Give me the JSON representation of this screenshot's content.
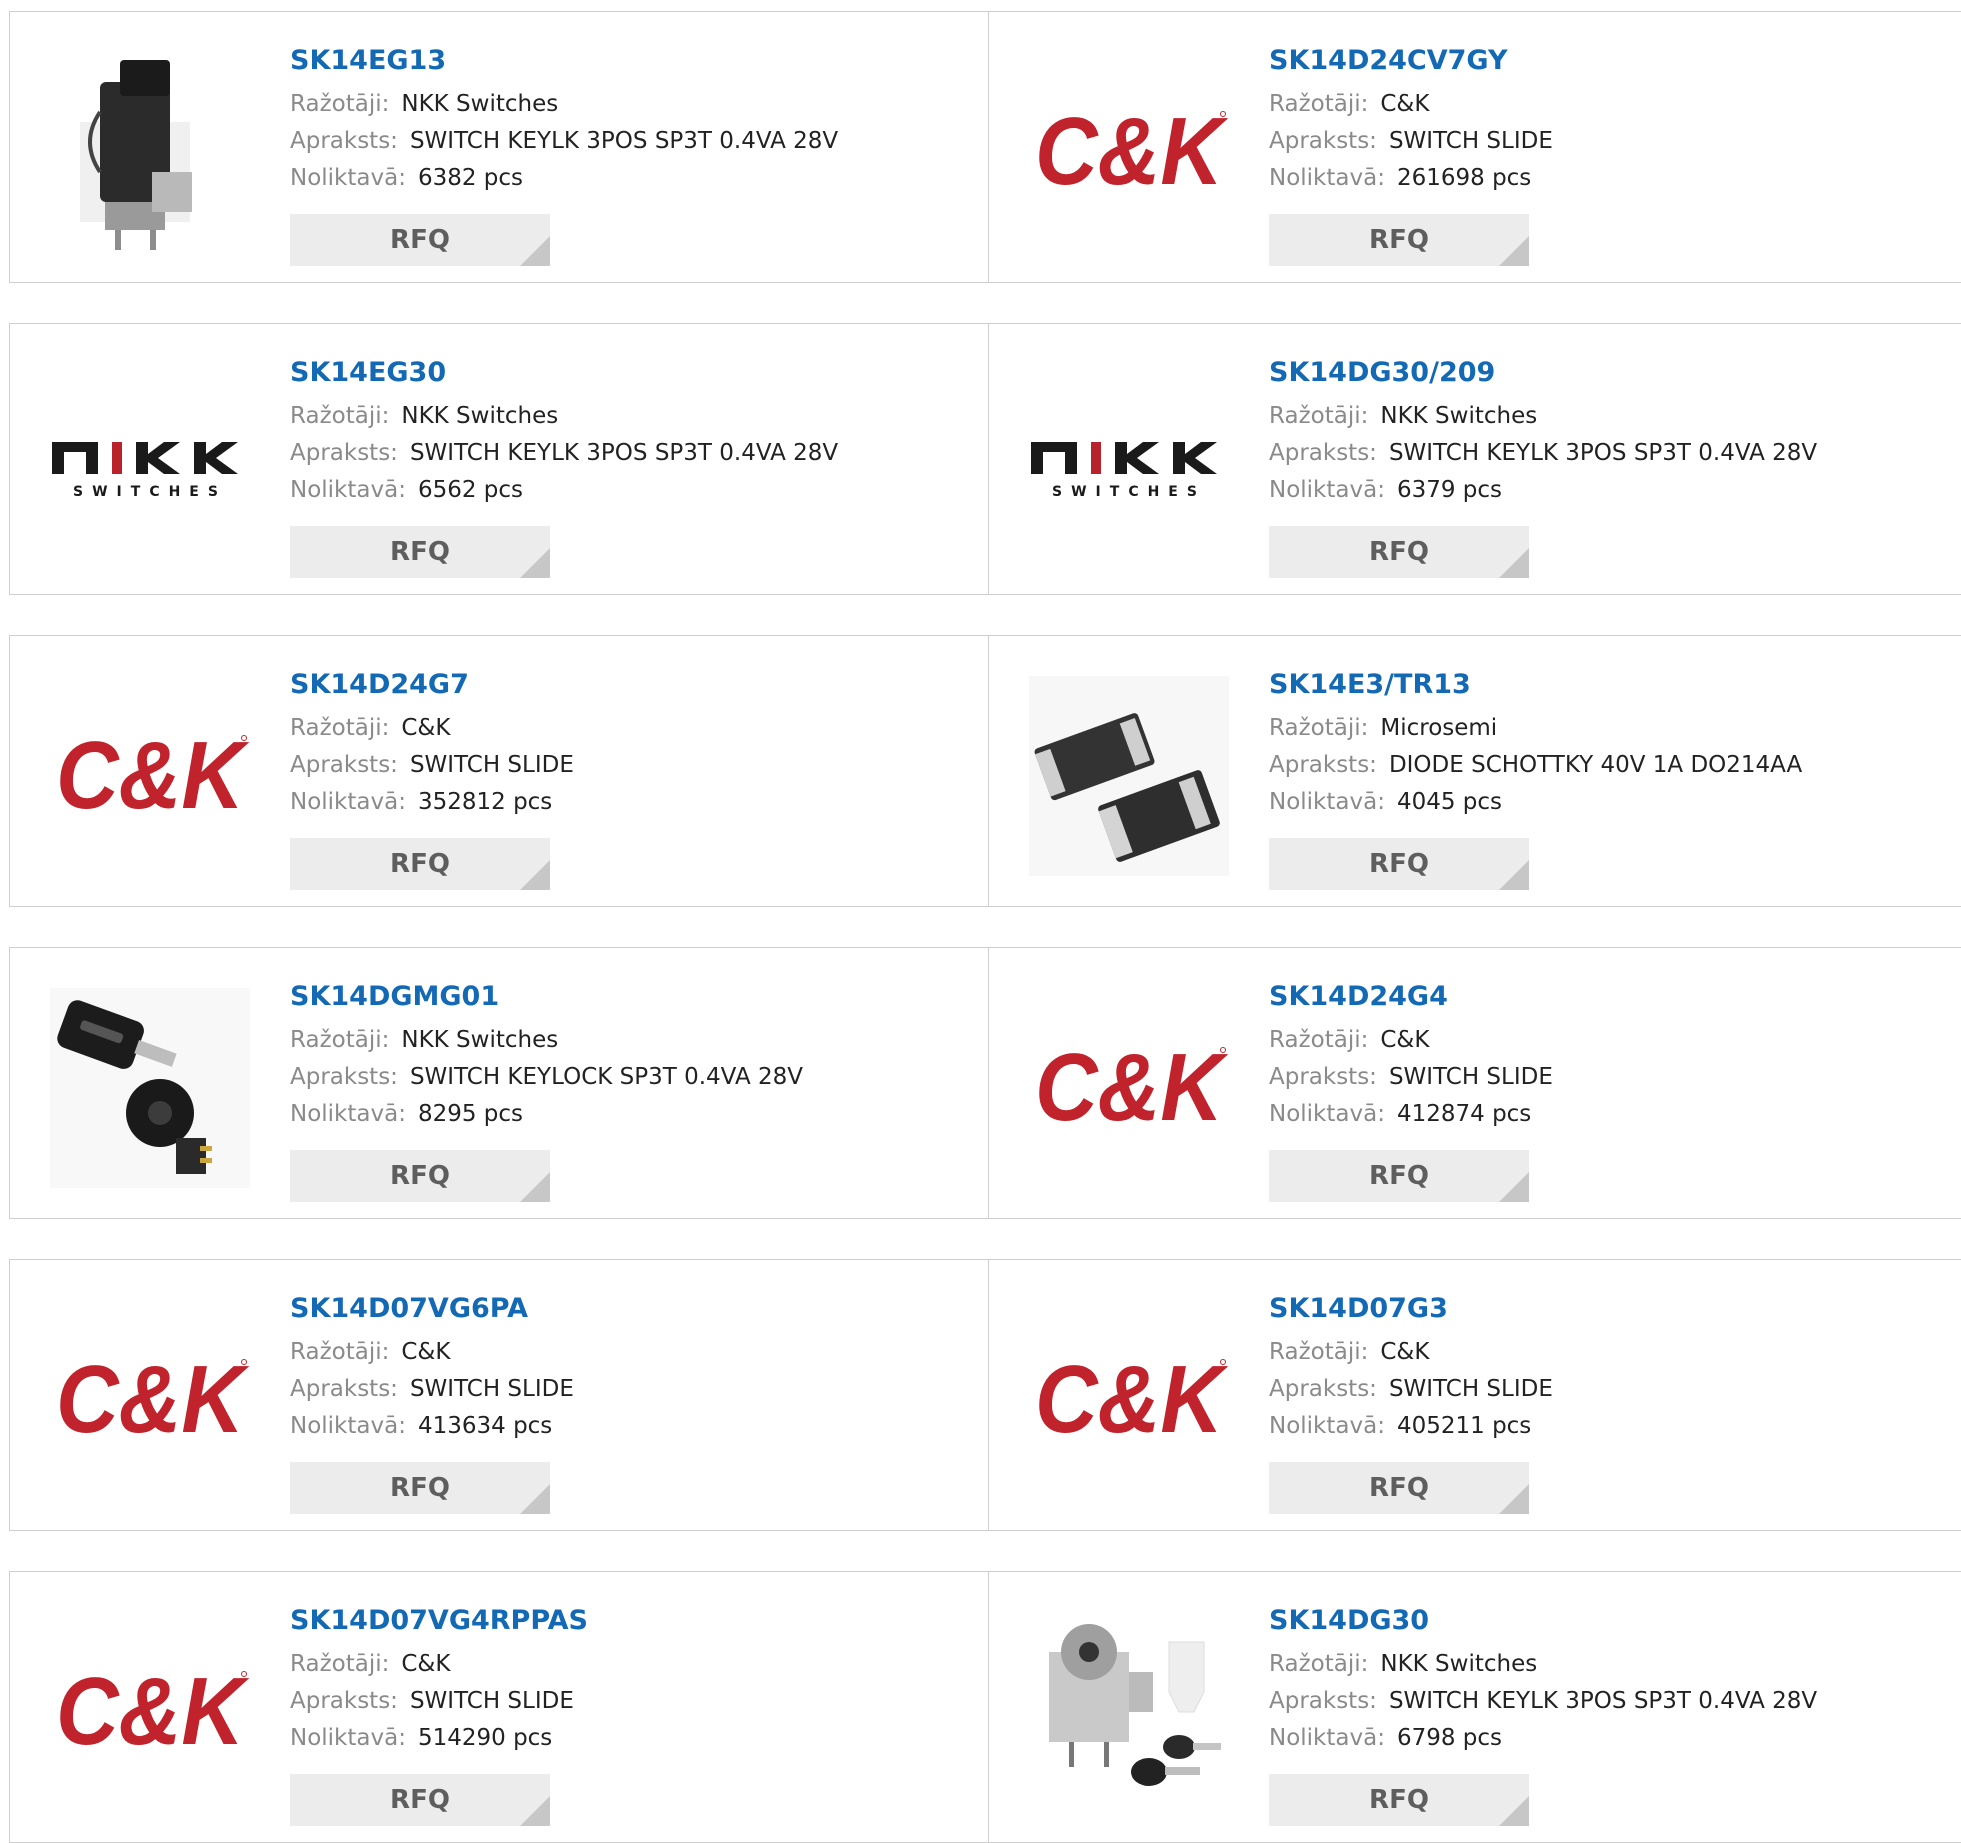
{
  "labels": {
    "manufacturer": "Ražotāji:",
    "description": "Apraksts:",
    "stock": "Noliktavā:",
    "rfq": "RFQ"
  },
  "products": [
    {
      "pn": "SK14EG13",
      "manufacturer": "NKK Switches",
      "description": "SWITCH KEYLK 3POS SP3T 0.4VA 28V",
      "stock": "6382 pcs",
      "image": "keylock-switch-photo"
    },
    {
      "pn": "SK14D24CV7GY",
      "manufacturer": "C&K",
      "description": "SWITCH SLIDE",
      "stock": "261698 pcs",
      "image": "ck-logo"
    },
    {
      "pn": "SK14EG30",
      "manufacturer": "NKK Switches",
      "description": "SWITCH KEYLK 3POS SP3T 0.4VA 28V",
      "stock": "6562 pcs",
      "image": "nkk-logo"
    },
    {
      "pn": "SK14DG30/209",
      "manufacturer": "NKK Switches",
      "description": "SWITCH KEYLK 3POS SP3T 0.4VA 28V",
      "stock": "6379 pcs",
      "image": "nkk-logo"
    },
    {
      "pn": "SK14D24G7",
      "manufacturer": "C&K",
      "description": "SWITCH SLIDE",
      "stock": "352812 pcs",
      "image": "ck-logo"
    },
    {
      "pn": "SK14E3/TR13",
      "manufacturer": "Microsemi",
      "description": "DIODE SCHOTTKY 40V 1A DO214AA",
      "stock": "4045 pcs",
      "image": "diode-photo"
    },
    {
      "pn": "SK14DGMG01",
      "manufacturer": "NKK Switches",
      "description": "SWITCH KEYLOCK SP3T 0.4VA 28V",
      "stock": "8295 pcs",
      "image": "key-and-lock-photo"
    },
    {
      "pn": "SK14D24G4",
      "manufacturer": "C&K",
      "description": "SWITCH SLIDE",
      "stock": "412874 pcs",
      "image": "ck-logo"
    },
    {
      "pn": "SK14D07VG6PA",
      "manufacturer": "C&K",
      "description": "SWITCH SLIDE",
      "stock": "413634 pcs",
      "image": "ck-logo"
    },
    {
      "pn": "SK14D07G3",
      "manufacturer": "C&K",
      "description": "SWITCH SLIDE",
      "stock": "405211 pcs",
      "image": "ck-logo"
    },
    {
      "pn": "SK14D07VG4RPPAS",
      "manufacturer": "C&K",
      "description": "SWITCH SLIDE",
      "stock": "514290 pcs",
      "image": "ck-logo"
    },
    {
      "pn": "SK14DG30",
      "manufacturer": "NKK Switches",
      "description": "SWITCH KEYLK 3POS SP3T 0.4VA 28V",
      "stock": "6798 pcs",
      "image": "keylock-kit-photo"
    }
  ],
  "logos": {
    "ck": {
      "text": "C&K",
      "color": "#c0232c"
    },
    "nkk": {
      "text": "NKK",
      "sub": "SWITCHES",
      "color": "#1a1a1a"
    }
  },
  "colors": {
    "link": "#1469b4",
    "border": "#cfcfcf",
    "button_bg": "#ececec",
    "label": "#8a8a8a"
  }
}
